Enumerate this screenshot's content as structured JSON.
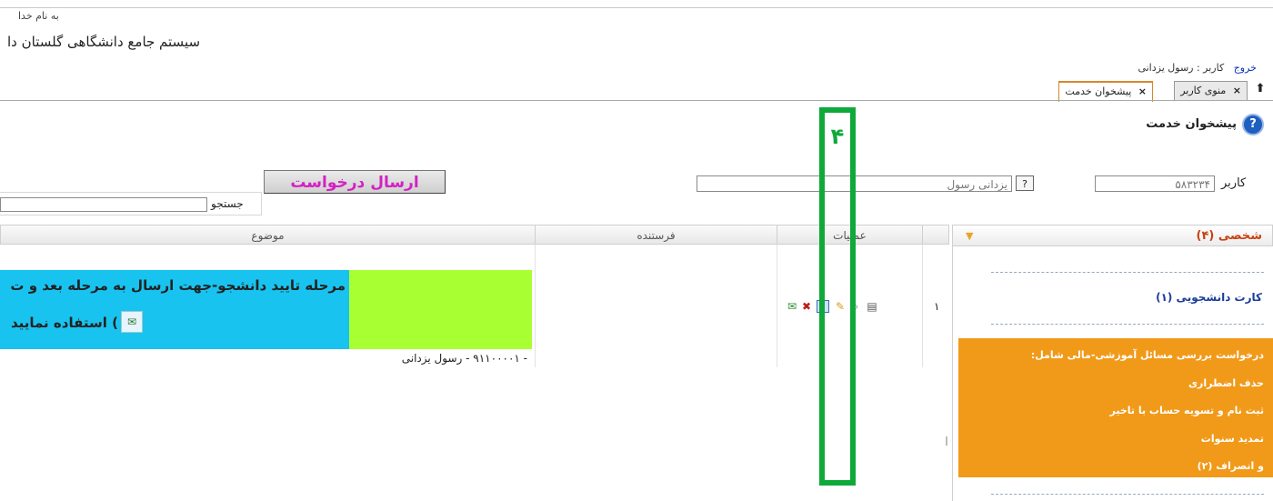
{
  "header": {
    "basmala": "به نام خدا",
    "system_title": "سیستم جامع دانشگاهی گلستان   دا",
    "user_label": "کاربر : رسول یزدانی",
    "logout_link": "خروج"
  },
  "tabs": [
    {
      "label": "منوی کاربر",
      "close": "×",
      "active": false
    },
    {
      "label": "پیشخوان خدمت",
      "close": "×",
      "active": true
    }
  ],
  "page": {
    "title": "پیشخوان خدمت",
    "help_glyph": "?"
  },
  "form": {
    "user_label": "کاربر",
    "user_code": "۵۸۳۲۳۴",
    "user_name": "یزدانی رسول",
    "lookup_button": "?",
    "send_button": "ارسال درخواست",
    "search_label": "جستجو",
    "search_value": ""
  },
  "table": {
    "headers": {
      "subject": "موضوع",
      "sender": "فرستنده",
      "operations": "عملیات"
    },
    "rows": [
      {
        "row_number": "۱",
        "subject_line1": "مرحله تایید دانشجو-جهت ارسال به مرحله بعد و ت",
        "subject_line2": ") استفاده نمایید",
        "sender_line": "- ۹۱۱۰۰۰۰۱ - رسول یزدانی"
      }
    ]
  },
  "operation_icons": [
    "send-icon",
    "delete-icon",
    "document-icon",
    "edit-icon",
    "view-icon",
    "calendar-icon"
  ],
  "annotation": {
    "number": "۴",
    "color": "#0fa93a"
  },
  "side_panel": {
    "title": "شخصی (۴)",
    "card_link": "کارت دانشجویی (۱)",
    "orange_items": [
      "درخواست بررسی مسائل آموزشی-مالی شامل:",
      "حذف اضطراری",
      "ثبت نام و تسویه حساب با تاخیر",
      "تمدید سنوات",
      "و انصراف (۲)"
    ]
  },
  "colors": {
    "subject_blue": "#19c3ef",
    "subject_green": "#a8ff32",
    "panel_orange": "#f19a1a",
    "send_text": "#d420c4"
  }
}
